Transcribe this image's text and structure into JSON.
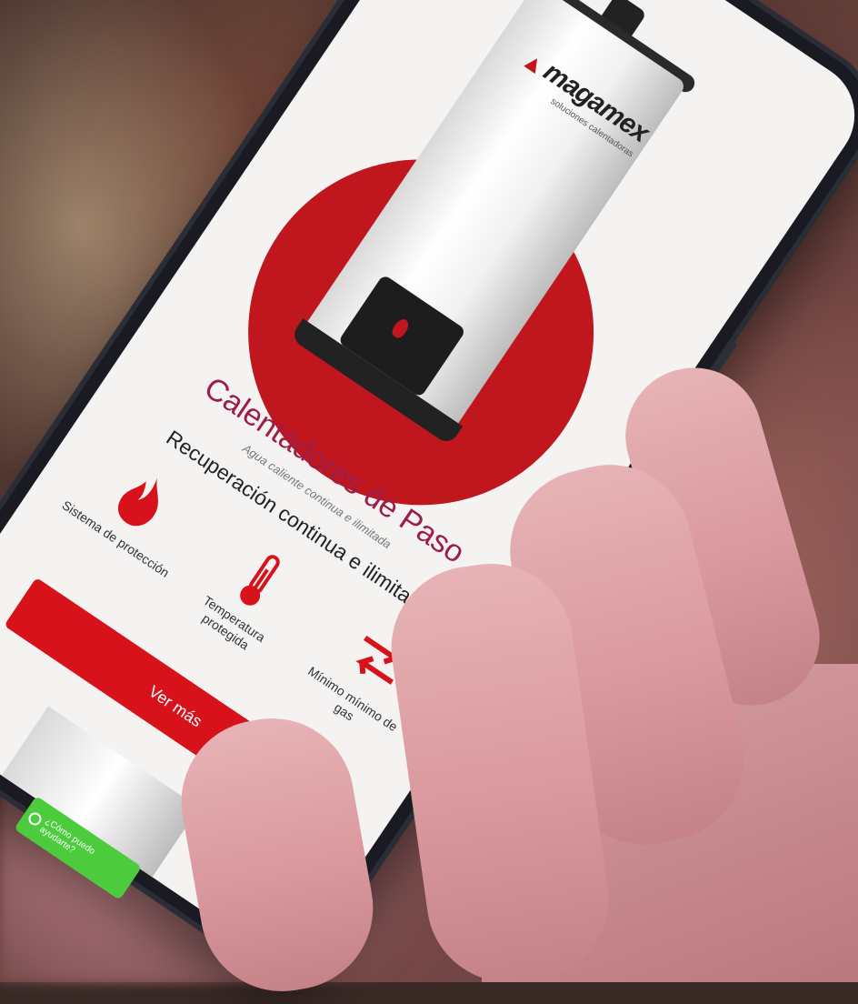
{
  "brand": {
    "name": "magamex",
    "tagline": "soluciones calentadoras"
  },
  "product": {
    "title": "Calentadores de Paso",
    "subtitle": "Agua caliente continua e ilimitada",
    "headline": "Recuperación continua e ilimitada"
  },
  "features": [
    {
      "icon": "flame-icon",
      "label": "Sistema de protección"
    },
    {
      "icon": "thermometer-icon",
      "label": "Temperatura protegida"
    },
    {
      "icon": "arrows-exchange-icon",
      "label": "Mínimo mínimo de gas"
    }
  ],
  "cta": {
    "label": "Ver más"
  },
  "whatsapp": {
    "label": "¿Cómo puedo ayudarte?"
  },
  "colors": {
    "accent": "#d8121b",
    "title": "#9c1d47",
    "whatsapp": "#4ccb3c"
  }
}
